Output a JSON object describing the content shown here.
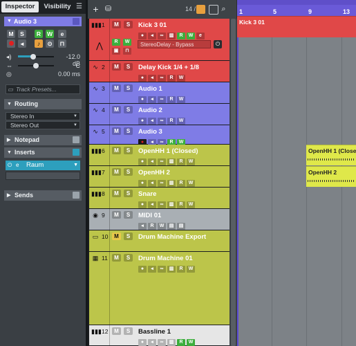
{
  "inspector": {
    "tabs": [
      "Inspector",
      "Visibility"
    ],
    "track_name": "Audio 3",
    "volume": "-12.0 dB",
    "pan": "C",
    "delay": "0.00 ms",
    "track_presets_placeholder": "Track Presets...",
    "sections": {
      "routing": "Routing",
      "notepad": "Notepad",
      "inserts": "Inserts",
      "sends": "Sends"
    },
    "routing_in": "Stereo In",
    "routing_out": "Stereo Out",
    "insert_slot": "Raum",
    "colors": {
      "track": "#7f7ce6",
      "insert": "#2d9fbd"
    }
  },
  "toolbar": {
    "track_count": "14 / 16"
  },
  "ruler": {
    "bars": [
      "1",
      "5",
      "9",
      "13"
    ]
  },
  "tracks": [
    {
      "num": "1",
      "name": "Kick 3 01",
      "type": "instrument",
      "color": "#e04848"
    },
    {
      "num": "2",
      "name": "Delay Kick 1/4 + 1/8",
      "type": "audio",
      "color": "#e04848"
    },
    {
      "num": "3",
      "name": "Audio 1",
      "type": "audio",
      "color": "#7f7ce6"
    },
    {
      "num": "4",
      "name": "Audio 2",
      "type": "audio",
      "color": "#7f7ce6"
    },
    {
      "num": "5",
      "name": "Audio 3",
      "type": "audio",
      "color": "#7f7ce6"
    },
    {
      "num": "6",
      "name": "OpenHH 1 (Closed)",
      "type": "instrument",
      "color": "#bcc54a"
    },
    {
      "num": "7",
      "name": "OpenHH 2",
      "type": "instrument",
      "color": "#bcc54a"
    },
    {
      "num": "8",
      "name": "Snare",
      "type": "instrument",
      "color": "#bcc54a"
    },
    {
      "num": "9",
      "name": "MIDI 01",
      "type": "midi",
      "color": "#a9afb4"
    },
    {
      "num": "10",
      "name": "Drum Machine Export",
      "type": "folder",
      "color": "#bcc54a"
    },
    {
      "num": "11",
      "name": "Drum Machine 01",
      "type": "drum",
      "color": "#bcc54a"
    },
    {
      "num": "12",
      "name": "Bassline 1",
      "type": "instrument",
      "color": "#e6e6e6"
    }
  ],
  "insert_fx": {
    "name": "StereoDelay - Bypass"
  },
  "events": [
    {
      "name": "Kick 3 01"
    },
    {
      "name": "OpenHH 1 (Closed)"
    },
    {
      "name": "OpenHH 2"
    }
  ]
}
